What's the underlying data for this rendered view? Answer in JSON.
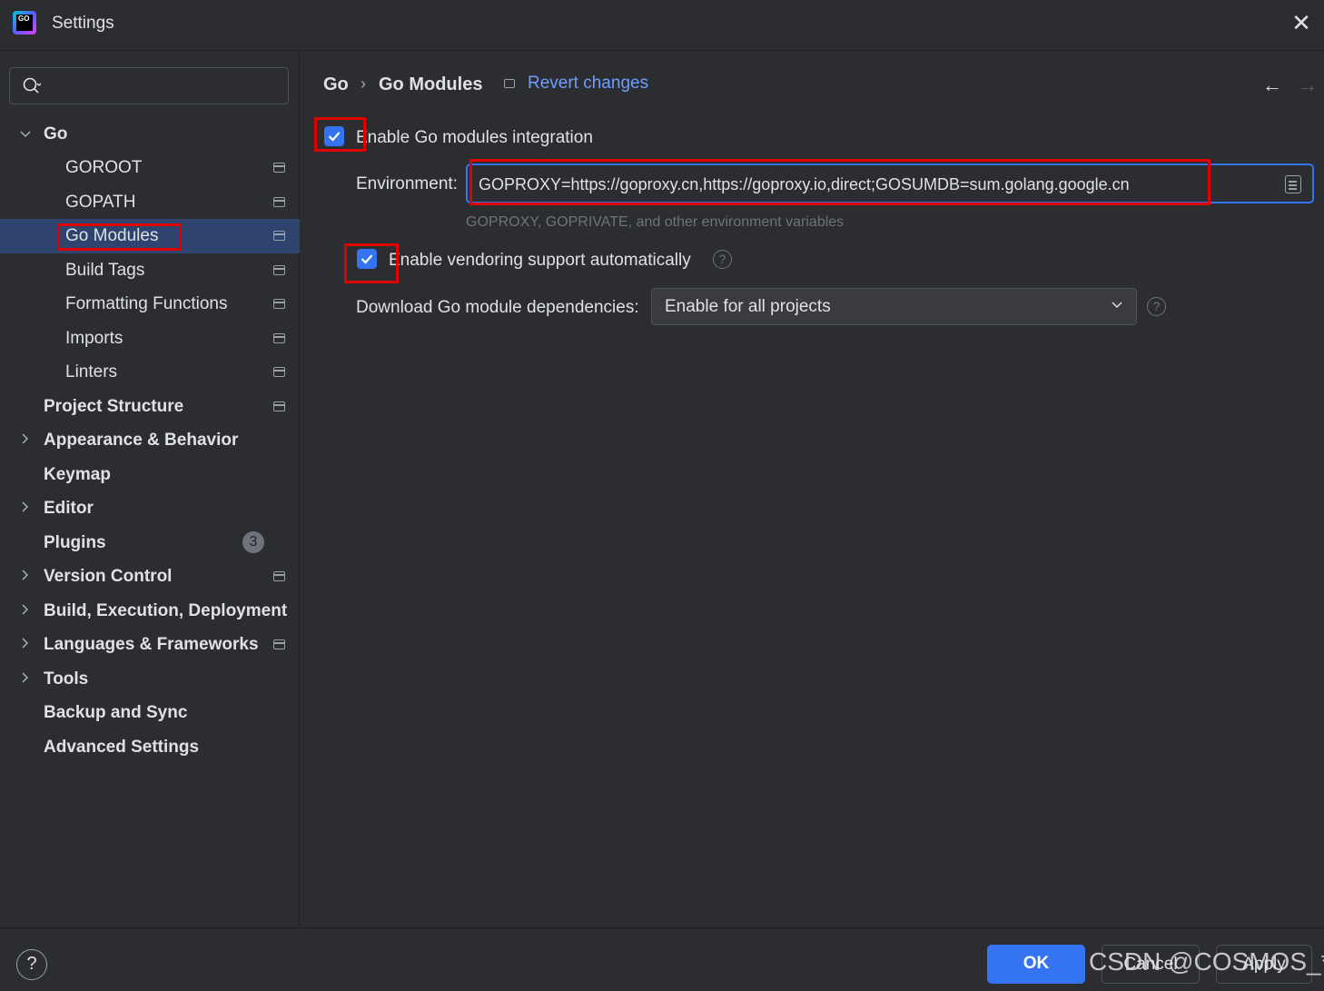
{
  "window": {
    "title": "Settings",
    "logo_text": "GO"
  },
  "sidebar": {
    "search_placeholder": "",
    "items": [
      {
        "label": "Go",
        "expanded": true
      },
      {
        "label": "GOROOT"
      },
      {
        "label": "GOPATH"
      },
      {
        "label": "Go Modules",
        "selected": true
      },
      {
        "label": "Build Tags"
      },
      {
        "label": "Formatting Functions"
      },
      {
        "label": "Imports"
      },
      {
        "label": "Linters"
      },
      {
        "label": "Project Structure"
      },
      {
        "label": "Appearance & Behavior"
      },
      {
        "label": "Keymap"
      },
      {
        "label": "Editor"
      },
      {
        "label": "Plugins",
        "badge": "3"
      },
      {
        "label": "Version Control"
      },
      {
        "label": "Build, Execution, Deployment"
      },
      {
        "label": "Languages & Frameworks"
      },
      {
        "label": "Tools"
      },
      {
        "label": "Backup and Sync"
      },
      {
        "label": "Advanced Settings"
      }
    ]
  },
  "header": {
    "breadcrumb_root": "Go",
    "breadcrumb_sep": "›",
    "breadcrumb_page": "Go Modules",
    "revert_label": "Revert changes",
    "back_arrow": "←",
    "forward_arrow": "→"
  },
  "settings": {
    "enable_modules_label": "Enable Go modules integration",
    "enable_modules_checked": true,
    "environment_label": "Environment:",
    "environment_value": "GOPROXY=https://goproxy.cn,https://goproxy.io,direct;GOSUMDB=sum.golang.google.cn",
    "environment_hint": "GOPROXY, GOPRIVATE, and other environment variables",
    "vendoring_label": "Enable vendoring support automatically",
    "vendoring_checked": true,
    "download_label": "Download Go module dependencies:",
    "download_value": "Enable for all projects",
    "help_glyph": "?"
  },
  "footer": {
    "help_glyph": "?",
    "ok_label": "OK",
    "cancel_label": "Cancel",
    "apply_label": "Apply"
  },
  "watermark": "CSDN @COSMOS_*",
  "colors": {
    "accent": "#3574f0",
    "selection": "#2e436e",
    "background": "#2b2d30",
    "link": "#6e9eff",
    "annotation_red": "#e00000"
  }
}
